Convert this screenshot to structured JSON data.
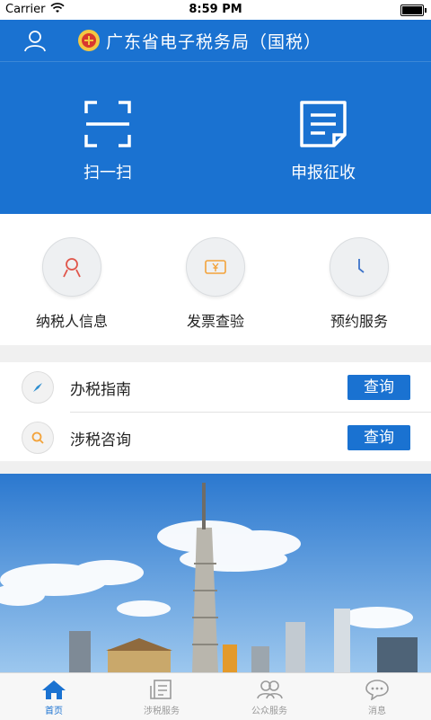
{
  "status_bar": {
    "carrier": "Carrier",
    "time": "8:59 PM",
    "battery_level": 1.0
  },
  "header": {
    "title": "广东省电子税务局（国税）",
    "user_icon": "user-icon",
    "logo_icon": "tax-emblem-icon"
  },
  "quick_actions": [
    {
      "label": "扫一扫",
      "icon": "scan-icon"
    },
    {
      "label": "申报征收",
      "icon": "document-icon"
    }
  ],
  "services": [
    {
      "label": "纳税人信息",
      "icon": "person-icon"
    },
    {
      "label": "发票查验",
      "icon": "invoice-icon"
    },
    {
      "label": "预约服务",
      "icon": "clock-icon"
    }
  ],
  "list": [
    {
      "label": "办税指南",
      "button": "查询",
      "icon": "compass-icon"
    },
    {
      "label": "涉税咨询",
      "button": "查询",
      "icon": "search-icon"
    }
  ],
  "tabs": [
    {
      "label": "首页",
      "icon": "home-icon",
      "active": true
    },
    {
      "label": "涉税服务",
      "icon": "tax-service-icon",
      "active": false
    },
    {
      "label": "公众服务",
      "icon": "people-icon",
      "active": false
    },
    {
      "label": "消息",
      "icon": "chat-icon",
      "active": false
    }
  ],
  "colors": {
    "primary": "#1a72d1",
    "accent_red": "#e0554a",
    "accent_orange": "#f3a33b",
    "accent_blue": "#3d73c9"
  }
}
